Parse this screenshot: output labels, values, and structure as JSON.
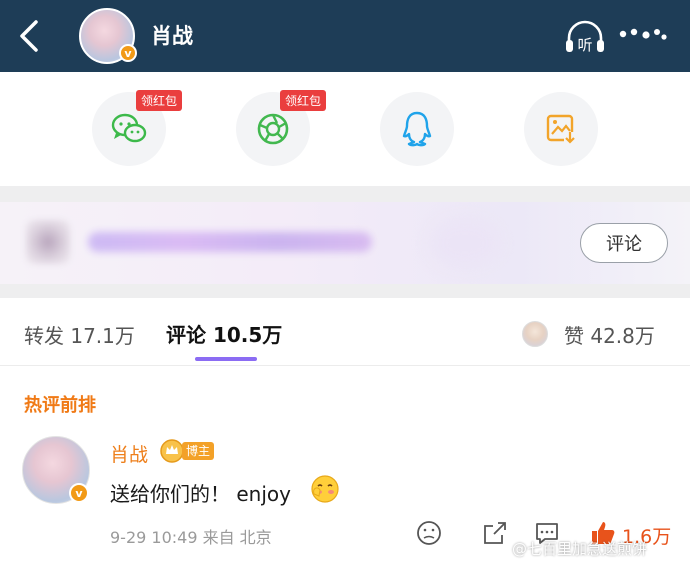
{
  "header": {
    "user_name": "肖战",
    "listen_label": "听",
    "verified_mark": "v"
  },
  "share": {
    "items": [
      {
        "icon": "wechat-icon",
        "badge": "领红包"
      },
      {
        "icon": "moments-icon",
        "badge": "领红包"
      },
      {
        "icon": "qq-icon",
        "badge": ""
      },
      {
        "icon": "save-image-icon",
        "badge": ""
      }
    ]
  },
  "banner": {
    "comment_button": "评论"
  },
  "tabs": {
    "repost": "转发 17.1万",
    "comments": "评论 10.5万",
    "likes": "赞 42.8万"
  },
  "section": {
    "hot_title": "热评前排"
  },
  "comment": {
    "author": "肖战",
    "blogger_label": "博主",
    "text": "送给你们的！ enjoy",
    "meta": "9-29 10:49  来自 北京",
    "like_count": "1.6万"
  },
  "watermark": "@七百里加急送煎饼",
  "colors": {
    "header_bg": "#1e3d57",
    "accent_orange": "#f07a16",
    "tab_underline": "#8b6cf3",
    "like_red": "#e8531b",
    "badge_red": "#ea3e3e"
  }
}
